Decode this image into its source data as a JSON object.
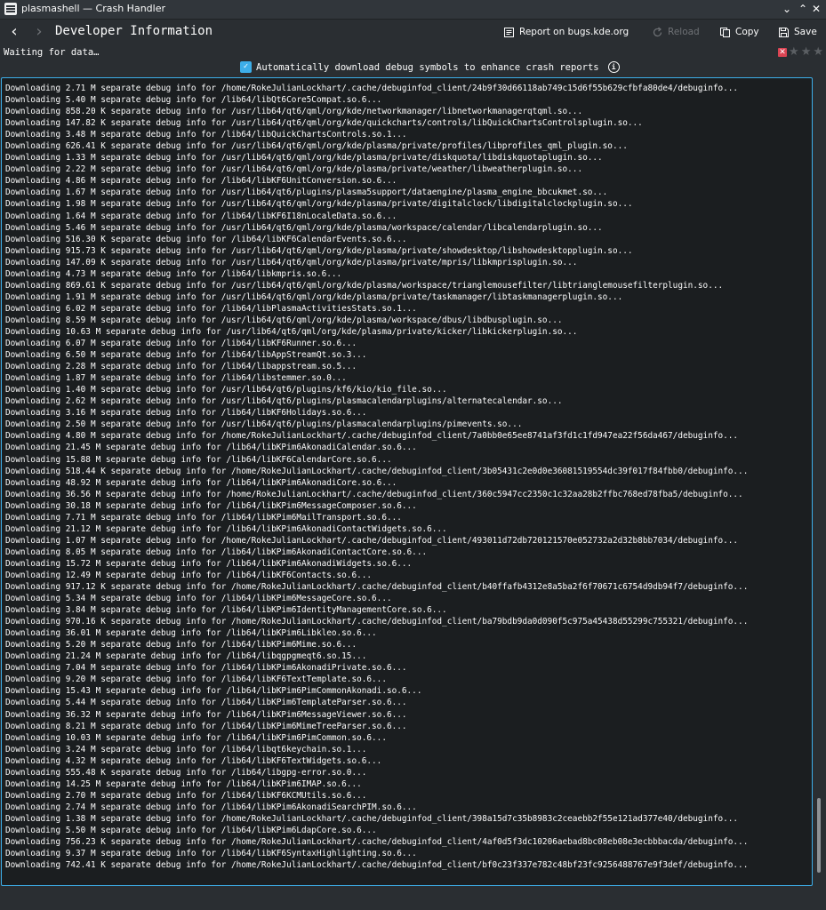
{
  "window": {
    "title": "plasmashell — Crash Handler",
    "minimize_glyph": "⌄",
    "maximize_glyph": "⌃",
    "close_glyph": "✕"
  },
  "toolbar": {
    "back_glyph": "‹",
    "forward_glyph": "›",
    "page_title": "Developer Information",
    "report_label": "Report on bugs.kde.org",
    "reload_label": "Reload",
    "copy_label": "Copy",
    "save_label": "Save"
  },
  "status": {
    "text": "Waiting for data…",
    "rating_error_glyph": "✕",
    "star_glyph": "★"
  },
  "debug_symbols": {
    "label": "Automatically download debug symbols to enhance crash reports",
    "checked": true,
    "check_glyph": "✓",
    "info_glyph": "i"
  },
  "log_lines": [
    "Downloading 2.71 M separate debug info for /home/RokeJulianLockhart/.cache/debuginfod_client/24b9f30d66118ab749c15d6f55b629cfbfa80de4/debuginfo...",
    "Downloading 5.40 M separate debug info for /lib64/libQt6Core5Compat.so.6...",
    "Downloading 858.20 K separate debug info for /usr/lib64/qt6/qml/org/kde/networkmanager/libnetworkmanagerqtqml.so...",
    "Downloading 147.82 K separate debug info for /usr/lib64/qt6/qml/org/kde/quickcharts/controls/libQuickChartsControlsplugin.so...",
    "Downloading 3.48 M separate debug info for /lib64/libQuickChartsControls.so.1...",
    "Downloading 626.41 K separate debug info for /usr/lib64/qt6/qml/org/kde/plasma/private/profiles/libprofiles_qml_plugin.so...",
    "Downloading 1.33 M separate debug info for /usr/lib64/qt6/qml/org/kde/plasma/private/diskquota/libdiskquotaplugin.so...",
    "Downloading 2.22 M separate debug info for /usr/lib64/qt6/qml/org/kde/plasma/private/weather/libweatherplugin.so...",
    "Downloading 4.86 M separate debug info for /lib64/libKF6UnitConversion.so.6...",
    "Downloading 1.67 M separate debug info for /usr/lib64/qt6/plugins/plasma5support/dataengine/plasma_engine_bbcukmet.so...",
    "Downloading 1.98 M separate debug info for /usr/lib64/qt6/qml/org/kde/plasma/private/digitalclock/libdigitalclockplugin.so...",
    "Downloading 1.64 M separate debug info for /lib64/libKF6I18nLocaleData.so.6...",
    "Downloading 5.46 M separate debug info for /usr/lib64/qt6/qml/org/kde/plasma/workspace/calendar/libcalendarplugin.so...",
    "Downloading 516.30 K separate debug info for /lib64/libKF6CalendarEvents.so.6...",
    "Downloading 915.73 K separate debug info for /usr/lib64/qt6/qml/org/kde/plasma/private/showdesktop/libshowdesktopplugin.so...",
    "Downloading 147.09 K separate debug info for /usr/lib64/qt6/qml/org/kde/plasma/private/mpris/libkmprisplugin.so...",
    "Downloading 4.73 M separate debug info for /lib64/libkmpris.so.6...",
    "Downloading 869.61 K separate debug info for /usr/lib64/qt6/qml/org/kde/plasma/workspace/trianglemousefilter/libtrianglemousefilterplugin.so...",
    "Downloading 1.91 M separate debug info for /usr/lib64/qt6/qml/org/kde/plasma/private/taskmanager/libtaskmanagerplugin.so...",
    "Downloading 6.02 M separate debug info for /lib64/libPlasmaActivitiesStats.so.1...",
    "Downloading 8.59 M separate debug info for /usr/lib64/qt6/qml/org/kde/plasma/workspace/dbus/libdbusplugin.so...",
    "Downloading 10.63 M separate debug info for /usr/lib64/qt6/qml/org/kde/plasma/private/kicker/libkickerplugin.so...",
    "Downloading 6.07 M separate debug info for /lib64/libKF6Runner.so.6...",
    "Downloading 6.50 M separate debug info for /lib64/libAppStreamQt.so.3...",
    "Downloading 2.28 M separate debug info for /lib64/libappstream.so.5...",
    "Downloading 1.87 M separate debug info for /lib64/libstemmer.so.0...",
    "Downloading 1.40 M separate debug info for /usr/lib64/qt6/plugins/kf6/kio/kio_file.so...",
    "Downloading 2.62 M separate debug info for /usr/lib64/qt6/plugins/plasmacalendarplugins/alternatecalendar.so...",
    "Downloading 3.16 M separate debug info for /lib64/libKF6Holidays.so.6...",
    "Downloading 2.50 M separate debug info for /usr/lib64/qt6/plugins/plasmacalendarplugins/pimevents.so...",
    "Downloading 4.80 M separate debug info for /home/RokeJulianLockhart/.cache/debuginfod_client/7a0bb0e65ee8741af3fd1c1fd947ea22f56da467/debuginfo...",
    "Downloading 21.45 M separate debug info for /lib64/libKPim6AkonadiCalendar.so.6...",
    "Downloading 15.88 M separate debug info for /lib64/libKF6CalendarCore.so.6...",
    "Downloading 518.44 K separate debug info for /home/RokeJulianLockhart/.cache/debuginfod_client/3b05431c2e0d0e36081519554dc39f017f84fbb0/debuginfo...",
    "Downloading 48.92 M separate debug info for /lib64/libKPim6AkonadiCore.so.6...",
    "Downloading 36.56 M separate debug info for /home/RokeJulianLockhart/.cache/debuginfod_client/360c5947cc2350c1c32aa28b2ffbc768ed78fba5/debuginfo...",
    "Downloading 30.18 M separate debug info for /lib64/libKPim6MessageComposer.so.6...",
    "Downloading 7.71 M separate debug info for /lib64/libKPim6MailTransport.so.6...",
    "Downloading 21.12 M separate debug info for /lib64/libKPim6AkonadiContactWidgets.so.6...",
    "Downloading 1.07 M separate debug info for /home/RokeJulianLockhart/.cache/debuginfod_client/493011d72db720121570e052732a2d32b8bb7034/debuginfo...",
    "Downloading 8.05 M separate debug info for /lib64/libKPim6AkonadiContactCore.so.6...",
    "Downloading 15.72 M separate debug info for /lib64/libKPim6AkonadiWidgets.so.6...",
    "Downloading 12.49 M separate debug info for /lib64/libKF6Contacts.so.6...",
    "Downloading 917.12 K separate debug info for /home/RokeJulianLockhart/.cache/debuginfod_client/b40ffafb4312e8a5ba2f6f70671c6754d9db94f7/debuginfo...",
    "Downloading 5.34 M separate debug info for /lib64/libKPim6MessageCore.so.6...",
    "Downloading 3.84 M separate debug info for /lib64/libKPim6IdentityManagementCore.so.6...",
    "Downloading 970.16 K separate debug info for /home/RokeJulianLockhart/.cache/debuginfod_client/ba79bdb9da0d090f5c975a45438d55299c755321/debuginfo...",
    "Downloading 36.01 M separate debug info for /lib64/libKPim6Libkleo.so.6...",
    "Downloading 5.20 M separate debug info for /lib64/libKPim6Mime.so.6...",
    "Downloading 21.24 M separate debug info for /lib64/libqgpgmeqt6.so.15...",
    "Downloading 7.04 M separate debug info for /lib64/libKPim6AkonadiPrivate.so.6...",
    "Downloading 9.20 M separate debug info for /lib64/libKF6TextTemplate.so.6...",
    "Downloading 15.43 M separate debug info for /lib64/libKPim6PimCommonAkonadi.so.6...",
    "Downloading 5.44 M separate debug info for /lib64/libKPim6TemplateParser.so.6...",
    "Downloading 36.32 M separate debug info for /lib64/libKPim6MessageViewer.so.6...",
    "Downloading 8.21 M separate debug info for /lib64/libKPim6MimeTreeParser.so.6...",
    "Downloading 10.03 M separate debug info for /lib64/libKPim6PimCommon.so.6...",
    "Downloading 3.24 M separate debug info for /lib64/libqt6keychain.so.1...",
    "Downloading 4.32 M separate debug info for /lib64/libKF6TextWidgets.so.6...",
    "Downloading 555.48 K separate debug info for /lib64/libgpg-error.so.0...",
    "Downloading 14.25 M separate debug info for /lib64/libKPim6IMAP.so.6...",
    "Downloading 2.70 M separate debug info for /lib64/libKF6KCMUtils.so.6...",
    "Downloading 2.74 M separate debug info for /lib64/libKPim6AkonadiSearchPIM.so.6...",
    "Downloading 1.38 M separate debug info for /home/RokeJulianLockhart/.cache/debuginfod_client/398a15d7c35b8983c2ceaebb2f55e121ad377e40/debuginfo...",
    "Downloading 5.50 M separate debug info for /lib64/libKPim6LdapCore.so.6...",
    "Downloading 756.23 K separate debug info for /home/RokeJulianLockhart/.cache/debuginfod_client/4af0d5f3dc10206aebad8bc08eb08e3ecbbbacda/debuginfo...",
    "Downloading 9.37 M separate debug info for /lib64/libKF6SyntaxHighlighting.so.6...",
    "Downloading 742.41 K separate debug info for /home/RokeJulianLockhart/.cache/debuginfod_client/bf0c23f337e782c48bf23fc9256488767e9f3def/debuginfo..."
  ]
}
